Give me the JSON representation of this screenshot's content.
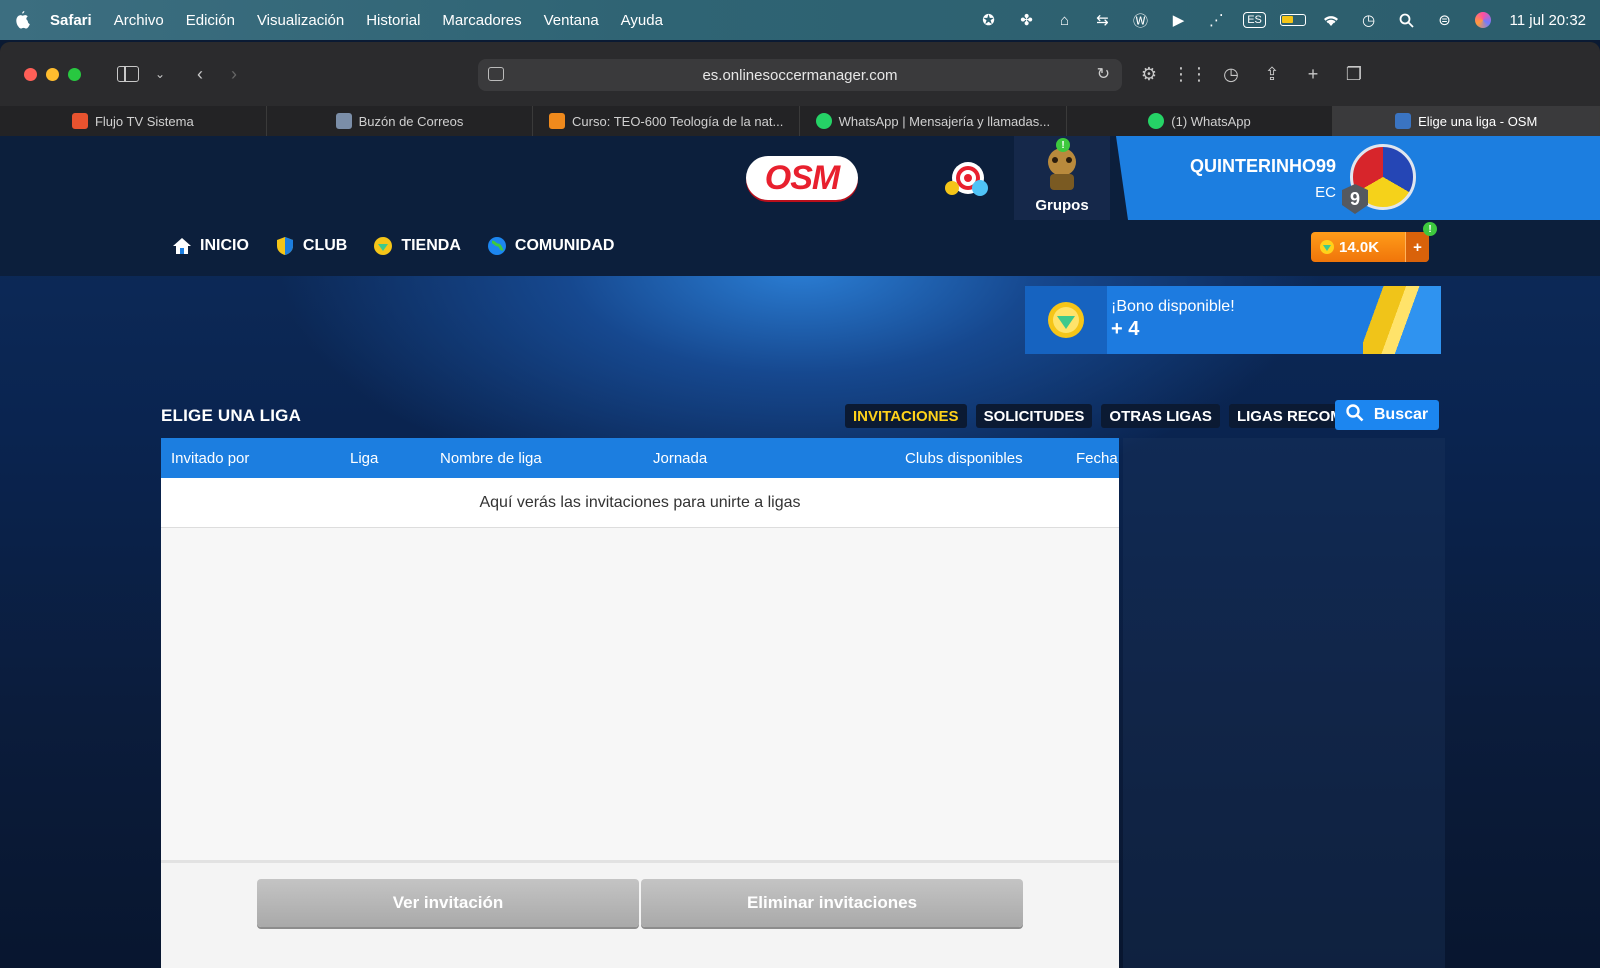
{
  "menubar": {
    "app": "Safari",
    "items": [
      "Archivo",
      "Edición",
      "Visualización",
      "Historial",
      "Marcadores",
      "Ventana",
      "Ayuda"
    ],
    "input_source": "ES",
    "clock": "11 jul  20:32"
  },
  "browser": {
    "url": "es.onlinesoccermanager.com",
    "tabs": [
      {
        "label": "Flujo TV Sistema",
        "color": "#e8532f"
      },
      {
        "label": "Buzón de Correos",
        "color": "#7b8ea8"
      },
      {
        "label": "Curso: TEO-600 Teología de la nat...",
        "color": "#f08a1c"
      },
      {
        "label": "WhatsApp | Mensajería y llamadas...",
        "color": "#25d366"
      },
      {
        "label": "(1) WhatsApp",
        "color": "#25d366"
      },
      {
        "label": "Elige una liga - OSM",
        "color": "#3a74c2"
      }
    ]
  },
  "osm": {
    "logo": "OSM",
    "groups_label": "Grupos",
    "groups_alert": "!",
    "username": "QUINTERINHO99",
    "country": "EC",
    "level": "9",
    "nav": [
      "INICIO",
      "CLUB",
      "TIENDA",
      "COMUNIDAD"
    ],
    "coins": "14.0K",
    "coins_plus": "+",
    "coins_alert": "!",
    "bonus_title": "¡Bono disponible!",
    "bonus_value": "+ 4",
    "panel_title": "ELIGE UNA LIGA",
    "filters": [
      "INVITACIONES",
      "SOLICITUDES",
      "OTRAS LIGAS",
      "LIGAS RECOMENDADAS"
    ],
    "search_label": "Buscar",
    "columns": [
      "Invitado por",
      "Liga",
      "Nombre de liga",
      "Jornada",
      "Clubs disponibles",
      "Fecha"
    ],
    "empty_message": "Aquí verás las invitaciones para unirte a ligas",
    "view_button": "Ver invitación",
    "delete_button": "Eliminar invitaciones"
  }
}
